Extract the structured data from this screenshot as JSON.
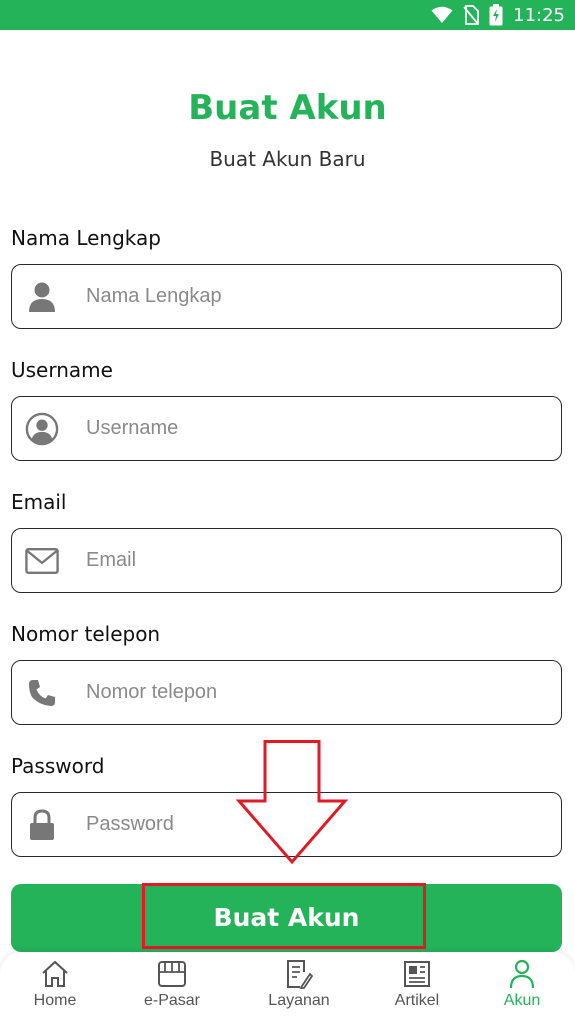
{
  "status_bar": {
    "time": "11:25",
    "color": "#25b35a"
  },
  "header": {
    "title": "Buat Akun",
    "subtitle": "Buat Akun Baru"
  },
  "form": {
    "fields": [
      {
        "label": "Nama Lengkap",
        "placeholder": "Nama Lengkap",
        "icon": "person-icon"
      },
      {
        "label": "Username",
        "placeholder": "Username",
        "icon": "account-circle-icon"
      },
      {
        "label": "Email",
        "placeholder": "Email",
        "icon": "mail-icon"
      },
      {
        "label": "Nomor telepon",
        "placeholder": "Nomor telepon",
        "icon": "phone-icon"
      },
      {
        "label": "Password",
        "placeholder": "Password",
        "icon": "lock-icon"
      }
    ],
    "submit_label": "Buat Akun"
  },
  "annotation": {
    "highlight_color": "#e21a26",
    "arrow": "down-arrow"
  },
  "bottom_nav": {
    "items": [
      {
        "label": "Home",
        "icon": "home-icon"
      },
      {
        "label": "e-Pasar",
        "icon": "store-icon"
      },
      {
        "label": "Layanan",
        "icon": "document-edit-icon"
      },
      {
        "label": "Artikel",
        "icon": "newspaper-icon"
      },
      {
        "label": "Akun",
        "icon": "account-icon",
        "active": true
      }
    ],
    "active_color": "#25b35a"
  }
}
